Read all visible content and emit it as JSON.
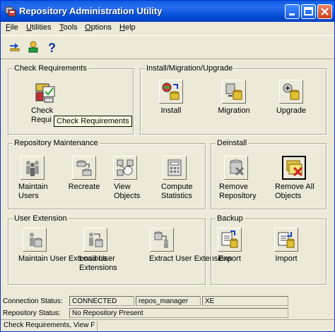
{
  "window": {
    "title": "Repository Administration Utility"
  },
  "menu": [
    {
      "label": "File",
      "key": "F"
    },
    {
      "label": "Utilities",
      "key": "U"
    },
    {
      "label": "Tools",
      "key": "T"
    },
    {
      "label": "Options",
      "key": "O"
    },
    {
      "label": "Help",
      "key": "H"
    }
  ],
  "groups": {
    "check": {
      "label": "Check Requirements",
      "items": [
        {
          "label": "Check Requirements"
        }
      ]
    },
    "install": {
      "label": "Install/Migration/Upgrade",
      "items": [
        {
          "label": "Install"
        },
        {
          "label": "Migration"
        },
        {
          "label": "Upgrade"
        }
      ]
    },
    "maintenance": {
      "label": "Repository Maintenance",
      "items": [
        {
          "label": "Maintain Users"
        },
        {
          "label": "Recreate"
        },
        {
          "label": "View Objects"
        },
        {
          "label": "Compute Statistics"
        }
      ]
    },
    "deinstall": {
      "label": "Deinstall",
      "items": [
        {
          "label": "Remove Repository"
        },
        {
          "label": "Remove All Objects"
        }
      ]
    },
    "extension": {
      "label": "User Extension",
      "items": [
        {
          "label": "Maintain User Extensions"
        },
        {
          "label": "Load User Extensions"
        },
        {
          "label": "Extract User Extensions"
        }
      ]
    },
    "backup": {
      "label": "Backup",
      "items": [
        {
          "label": "Export"
        },
        {
          "label": "Import"
        }
      ]
    }
  },
  "tooltip": "Check Requirements",
  "check_visible_label": "Check",
  "check_visible_label2": "Requi",
  "status": {
    "connection_label": "Connection Status:",
    "connection_value": "CONNECTED",
    "user": "repos_manager",
    "db": "XE",
    "repository_label": "Repository Status:",
    "repository_value": "No Repository Present",
    "message": "Check Requirements, View F"
  }
}
